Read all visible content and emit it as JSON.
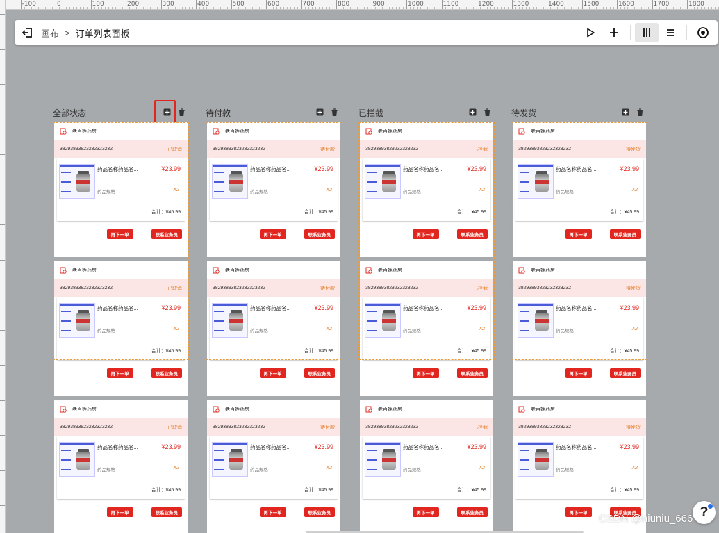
{
  "ruler": {
    "labels": [
      "-100",
      "0",
      "100",
      "200",
      "300",
      "400",
      "500",
      "600",
      "700",
      "800",
      "900",
      "1000",
      "1100",
      "1200",
      "1300",
      "1400",
      "1500",
      "1600",
      "1700",
      "1800"
    ]
  },
  "toolbar": {
    "breadcrumb_root": "画布",
    "breadcrumb_sep": ">",
    "breadcrumb_current": "订单列表面板"
  },
  "colors": {
    "accent_red": "#e0261e",
    "status_orange": "#e57a1f",
    "order_bar_bg": "#fbe5e5",
    "selection_dash": "#e89b3c"
  },
  "columns": [
    {
      "title": "全部状态",
      "status": "已取消",
      "highlight_add": true
    },
    {
      "title": "待付款",
      "status": "待付款",
      "highlight_add": false
    },
    {
      "title": "已拦截",
      "status": "已拦截",
      "highlight_add": false
    },
    {
      "title": "待发货",
      "status": "待发货",
      "highlight_add": false
    }
  ],
  "card": {
    "store_name": "老百姓药房",
    "order_no": "38293893823232323232",
    "goods_name": "药品名称药品名...",
    "price": "¥23.99",
    "spec": "药品规格",
    "qty": "X2",
    "total": "合计：¥45.99",
    "reorder_label": "再下一单",
    "contact_label": "联系业务员"
  },
  "help": {
    "label": "?"
  },
  "watermark": "CSDN @niuniu_666"
}
